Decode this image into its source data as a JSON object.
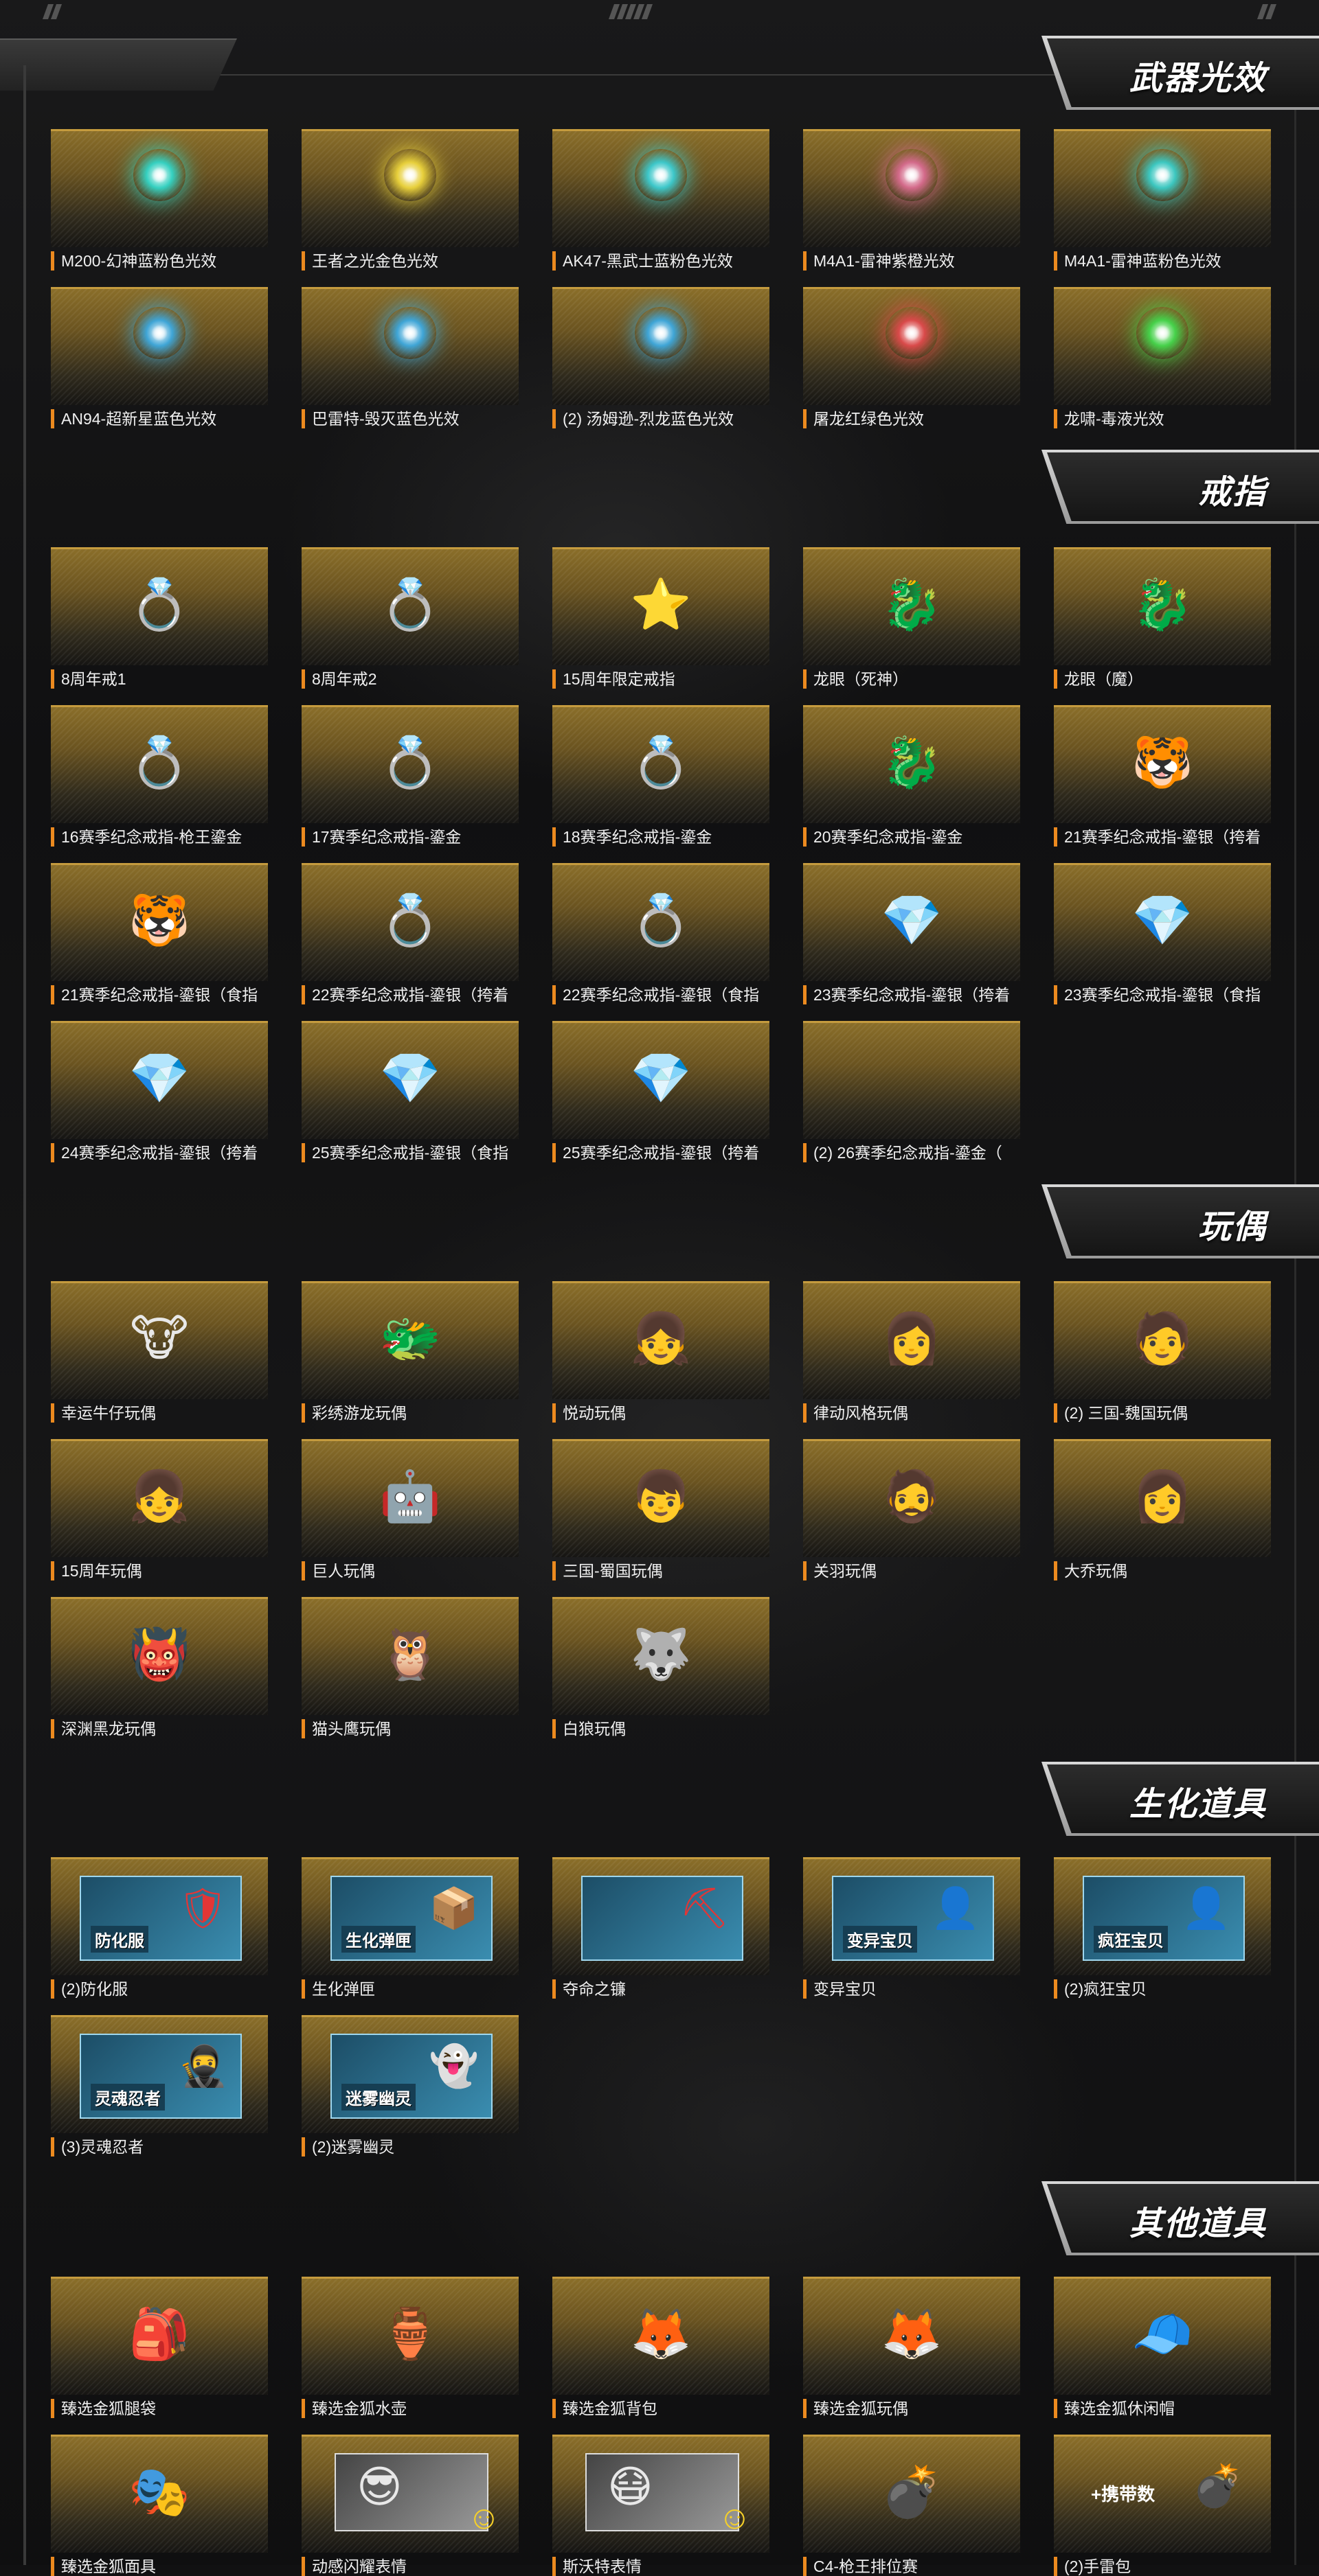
{
  "colors": {
    "accent_label": "#ec8a1f",
    "card_gold": "#8a6e29",
    "card_border": "#c59b3e",
    "header_text": "#ffffff",
    "background": "#111112"
  },
  "sections": [
    {
      "title": "武器光效",
      "items": [
        {
          "label": "M200-幻神蓝粉色光效",
          "icon": "glow-orb-teal-pink",
          "color": "#35d0c0"
        },
        {
          "label": "王者之光金色光效",
          "icon": "glow-orb-gold",
          "color": "#e7cf3b"
        },
        {
          "label": "AK47-黑武士蓝粉色光效",
          "icon": "glow-orb-teal-pink",
          "color": "#3dc7c9"
        },
        {
          "label": "M4A1-雷神紫橙光效",
          "icon": "glow-orb-purple-orange",
          "color": "#d36a8a"
        },
        {
          "label": "M4A1-雷神蓝粉色光效",
          "icon": "glow-orb-teal-pink",
          "color": "#3cc7c0"
        },
        {
          "label": "AN94-超新星蓝色光效",
          "icon": "glow-orb-blue",
          "color": "#3fa5d6"
        },
        {
          "label": "巴雷特-毁灭蓝色光效",
          "icon": "glow-orb-blue",
          "color": "#3fa5d6"
        },
        {
          "label": "(2) 汤姆逊-烈龙蓝色光效",
          "icon": "glow-orb-blue",
          "color": "#3fa5d6"
        },
        {
          "label": "屠龙红绿色光效",
          "icon": "glow-orb-red-green",
          "color": "#d94a4a"
        },
        {
          "label": "龙啸-毒液光效",
          "icon": "glow-orb-green",
          "color": "#46d14a"
        }
      ]
    },
    {
      "title": "戒指",
      "items": [
        {
          "label": "8周年戒1",
          "icon": "ring-icon",
          "glyph": "💍"
        },
        {
          "label": "8周年戒2",
          "icon": "ring-icon",
          "glyph": "💍"
        },
        {
          "label": "15周年限定戒指",
          "icon": "star-ring-icon",
          "glyph": "⭐"
        },
        {
          "label": "龙眼（死神）",
          "icon": "dragon-ring-icon",
          "glyph": "🐉"
        },
        {
          "label": "龙眼（魔）",
          "icon": "dragon-ring-icon",
          "glyph": "🐉"
        },
        {
          "label": "16赛季纪念戒指-枪王鎏金",
          "icon": "ring-icon",
          "glyph": "💍"
        },
        {
          "label": "17赛季纪念戒指-鎏金",
          "icon": "ring-icon",
          "glyph": "💍"
        },
        {
          "label": "18赛季纪念戒指-鎏金",
          "icon": "ring-icon",
          "glyph": "💍"
        },
        {
          "label": "20赛季纪念戒指-鎏金",
          "icon": "dragon-ring-icon",
          "glyph": "🐉"
        },
        {
          "label": "21赛季纪念戒指-鎏银（挎着",
          "icon": "tiger-ring-icon",
          "glyph": "🐯"
        },
        {
          "label": "21赛季纪念戒指-鎏银（食指",
          "icon": "tiger-ring-icon",
          "glyph": "🐯"
        },
        {
          "label": "22赛季纪念戒指-鎏银（挎着",
          "icon": "ring-icon",
          "glyph": "💍"
        },
        {
          "label": "22赛季纪念戒指-鎏银（食指",
          "icon": "ring-icon",
          "glyph": "💍"
        },
        {
          "label": "23赛季纪念戒指-鎏银（挎着",
          "icon": "emerald-ring-icon",
          "glyph": "💎"
        },
        {
          "label": "23赛季纪念戒指-鎏银（食指",
          "icon": "emerald-ring-icon",
          "glyph": "💎"
        },
        {
          "label": "24赛季纪念戒指-鎏银（挎着",
          "icon": "emerald-ring-icon",
          "glyph": "💎"
        },
        {
          "label": "25赛季纪念戒指-鎏银（食指",
          "icon": "emerald-ring-icon",
          "glyph": "💎"
        },
        {
          "label": "25赛季纪念戒指-鎏银（挎着",
          "icon": "emerald-ring-icon",
          "glyph": "💎"
        },
        {
          "label": "(2) 26赛季纪念戒指-鎏金（",
          "icon": "empty-thumb",
          "glyph": ""
        }
      ]
    },
    {
      "title": "玩偶",
      "items": [
        {
          "label": "幸运牛仔玩偶",
          "icon": "doll-icon",
          "glyph": "🐮"
        },
        {
          "label": "彩绣游龙玩偶",
          "icon": "doll-icon",
          "glyph": "🐲"
        },
        {
          "label": "悦动玩偶",
          "icon": "doll-icon",
          "glyph": "👧"
        },
        {
          "label": "律动风格玩偶",
          "icon": "doll-icon",
          "glyph": "👩"
        },
        {
          "label": "(2) 三国-魏国玩偶",
          "icon": "doll-icon",
          "glyph": "🧑"
        },
        {
          "label": "15周年玩偶",
          "icon": "doll-icon",
          "glyph": "👧"
        },
        {
          "label": "巨人玩偶",
          "icon": "doll-icon",
          "glyph": "🤖"
        },
        {
          "label": "三国-蜀国玩偶",
          "icon": "doll-icon",
          "glyph": "👦"
        },
        {
          "label": "关羽玩偶",
          "icon": "doll-icon",
          "glyph": "🧔"
        },
        {
          "label": "大乔玩偶",
          "icon": "doll-icon",
          "glyph": "👩"
        },
        {
          "label": "深渊黑龙玩偶",
          "icon": "doll-icon",
          "glyph": "👹"
        },
        {
          "label": "猫头鹰玩偶",
          "icon": "owl-icon",
          "glyph": "🦉"
        },
        {
          "label": "白狼玩偶",
          "icon": "doll-icon",
          "glyph": "🐺"
        }
      ]
    },
    {
      "title": "生化道具",
      "items": [
        {
          "label": "(2)防化服",
          "icon": "hazmat-suit-icon",
          "banner": "防化服",
          "glyph": "🛡"
        },
        {
          "label": "生化弹匣",
          "icon": "ammo-box-icon",
          "banner": "生化弹匣",
          "glyph": "📦"
        },
        {
          "label": "夺命之镰",
          "icon": "scythe-icon",
          "banner": "",
          "glyph": "⛏"
        },
        {
          "label": "变异宝贝",
          "icon": "mutant-icon",
          "banner": "变异宝贝",
          "glyph": "👤"
        },
        {
          "label": "(2)疯狂宝贝",
          "icon": "mutant-icon",
          "banner": "疯狂宝贝",
          "glyph": "👤"
        },
        {
          "label": "(3)灵魂忍者",
          "icon": "ninja-icon",
          "banner": "灵魂忍者",
          "glyph": "🥷"
        },
        {
          "label": "(2)迷雾幽灵",
          "icon": "ghost-icon",
          "banner": "迷雾幽灵",
          "glyph": "👻"
        }
      ]
    },
    {
      "title": "其他道具",
      "items": [
        {
          "label": "臻选金狐腿袋",
          "icon": "leg-pouch-icon",
          "glyph": "🎒"
        },
        {
          "label": "臻选金狐水壶",
          "icon": "canteen-icon",
          "glyph": "🏺"
        },
        {
          "label": "臻选金狐背包",
          "icon": "backpack-icon",
          "glyph": "🦊"
        },
        {
          "label": "臻选金狐玩偶",
          "icon": "doll-icon",
          "glyph": "🦊"
        },
        {
          "label": "臻选金狐休闲帽",
          "icon": "cap-icon",
          "glyph": "🧢"
        },
        {
          "label": "臻选金狐面具",
          "icon": "mask-icon",
          "glyph": "🎭"
        },
        {
          "label": "动感闪耀表情",
          "icon": "emote-icon",
          "glyph": "😎"
        },
        {
          "label": "斯沃特表情",
          "icon": "emote-icon",
          "glyph": "😷"
        },
        {
          "label": "C4-枪王排位赛",
          "icon": "c4-bomb-icon",
          "glyph": "💣"
        },
        {
          "label": "(2)手雷包",
          "icon": "grenade-pack-icon",
          "banner": "+携带数",
          "glyph": "💣"
        }
      ]
    }
  ]
}
